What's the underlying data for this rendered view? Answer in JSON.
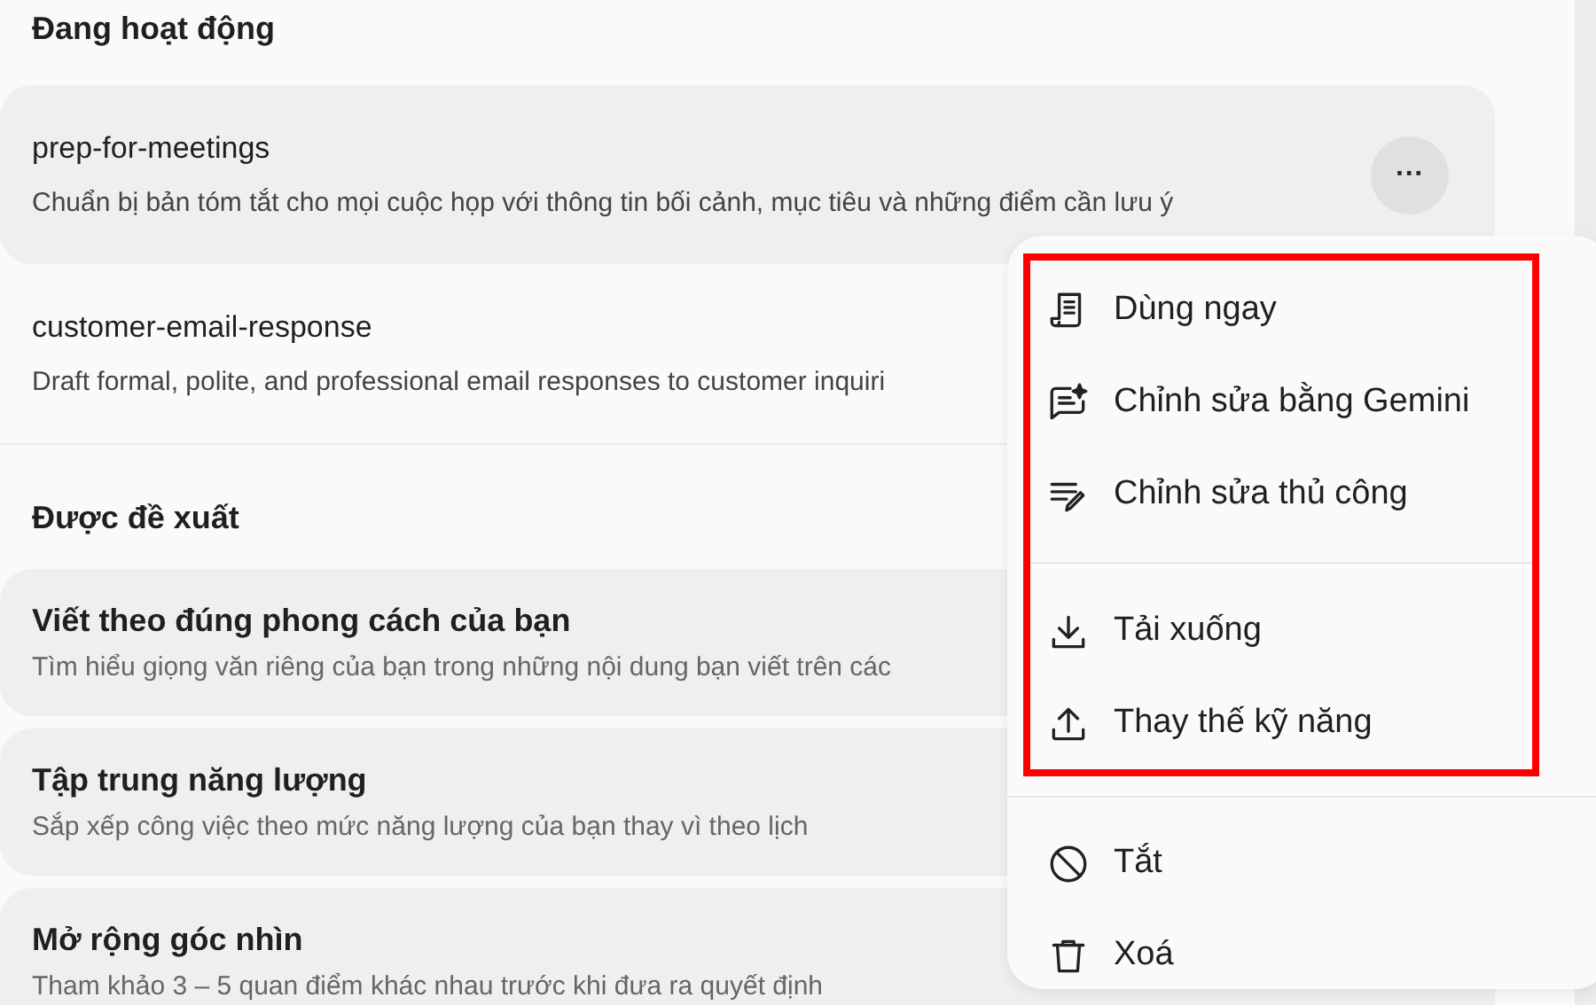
{
  "sections": [
    {
      "title": "Đang hoạt động",
      "kind": "active",
      "items": [
        {
          "name": "prep-for-meetings",
          "description": "Chuẩn bị bản tóm tắt cho mọi cuộc họp với thông tin bối cảnh, mục tiêu và những điểm cần lưu ý",
          "selected": true,
          "more_button": "···"
        },
        {
          "name": "customer-email-response",
          "description": "Draft formal, polite, and professional email responses to customer inquiri",
          "selected": false
        }
      ]
    },
    {
      "title": "Được đề xuất",
      "kind": "suggested",
      "items": [
        {
          "name": "Viết theo đúng phong cách của bạn",
          "description": "Tìm hiểu giọng văn riêng của bạn trong những nội dung bạn viết trên các",
          "selected": false
        },
        {
          "name": "Tập trung năng lượng",
          "description": "Sắp xếp công việc theo mức năng lượng của bạn thay vì theo lịch",
          "selected": false
        },
        {
          "name": "Mở rộng góc nhìn",
          "description": "Tham khảo 3 – 5 quan điểm khác nhau trước khi đưa ra quyết định",
          "selected": false
        }
      ]
    }
  ],
  "menu": {
    "groups": [
      {
        "highlighted": true,
        "items": [
          {
            "label": "Dùng ngay"
          },
          {
            "label": "Chỉnh sửa bằng Gemini"
          },
          {
            "label": "Chỉnh sửa thủ công"
          }
        ]
      },
      {
        "highlighted": true,
        "items": [
          {
            "label": "Tải xuống"
          },
          {
            "label": "Thay thế kỹ năng"
          }
        ]
      },
      {
        "highlighted": false,
        "items": [
          {
            "label": "Tắt"
          },
          {
            "label": "Xoá"
          }
        ]
      }
    ]
  }
}
